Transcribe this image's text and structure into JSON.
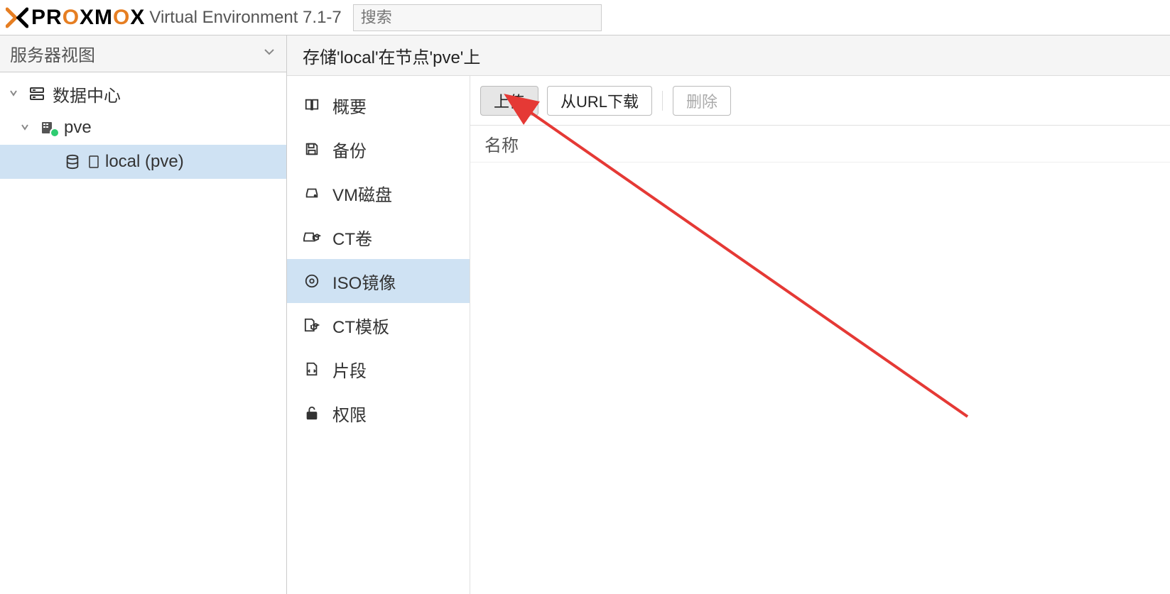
{
  "header": {
    "brand_pre": "PR",
    "brand_ox1": "O",
    "brand_mid": "XM",
    "brand_ox2": "O",
    "brand_suf": "X",
    "version": "Virtual Environment 7.1-7",
    "search_placeholder": "搜索"
  },
  "left_pane": {
    "view_selector": "服务器视图",
    "tree": {
      "datacenter": "数据中心",
      "node": "pve",
      "storage": "local (pve)"
    }
  },
  "content": {
    "title": "存储'local'在节点'pve'上",
    "side_nav": [
      {
        "key": "summary",
        "label": "概要",
        "icon": "book"
      },
      {
        "key": "backup",
        "label": "备份",
        "icon": "floppy"
      },
      {
        "key": "vmdisk",
        "label": "VM磁盘",
        "icon": "hdd"
      },
      {
        "key": "ctvol",
        "label": "CT卷",
        "icon": "hdd-cube"
      },
      {
        "key": "iso",
        "label": "ISO镜像",
        "icon": "disc",
        "active": true
      },
      {
        "key": "cttmpl",
        "label": "CT模板",
        "icon": "file-cube"
      },
      {
        "key": "snippet",
        "label": "片段",
        "icon": "file-code"
      },
      {
        "key": "perm",
        "label": "权限",
        "icon": "unlock"
      }
    ],
    "toolbar": {
      "upload": "上传",
      "download_url": "从URL下载",
      "delete": "删除"
    },
    "columns": {
      "name": "名称"
    }
  },
  "colors": {
    "brand_orange": "#e67e22",
    "selection": "#cfe2f3",
    "arrow": "#e53935"
  }
}
